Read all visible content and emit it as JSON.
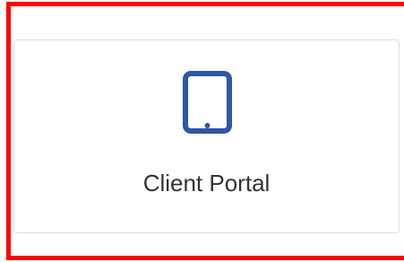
{
  "card": {
    "label": "Client Portal",
    "icon": "tablet-icon"
  },
  "colors": {
    "highlight_border": "#ff0000",
    "icon_blue": "#2f56a6",
    "label_text": "#333333",
    "card_border": "#dedede"
  }
}
